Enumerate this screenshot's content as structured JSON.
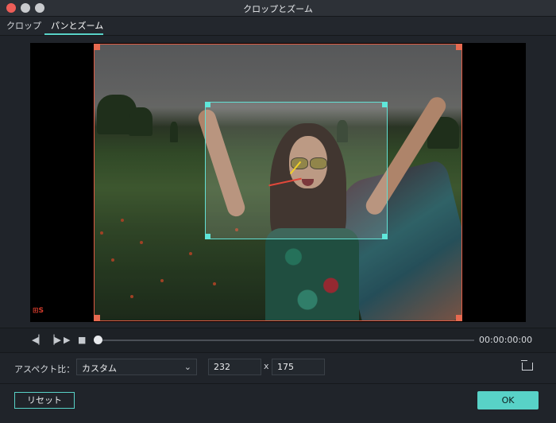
{
  "window": {
    "title": "クロップとズーム"
  },
  "tabs": [
    {
      "label": "クロップ"
    },
    {
      "label": "パンとズーム",
      "active": true
    }
  ],
  "player": {
    "timecode": "00:00:00:00"
  },
  "aspect": {
    "label": "アスペクト比：",
    "selected": "カスタム",
    "width": "232",
    "separator": "x",
    "height": "175"
  },
  "buttons": {
    "reset": "リセット",
    "ok": "OK"
  },
  "colors": {
    "accent": "#58d2c7",
    "frame": "#e05b44",
    "background": "#20242a"
  }
}
